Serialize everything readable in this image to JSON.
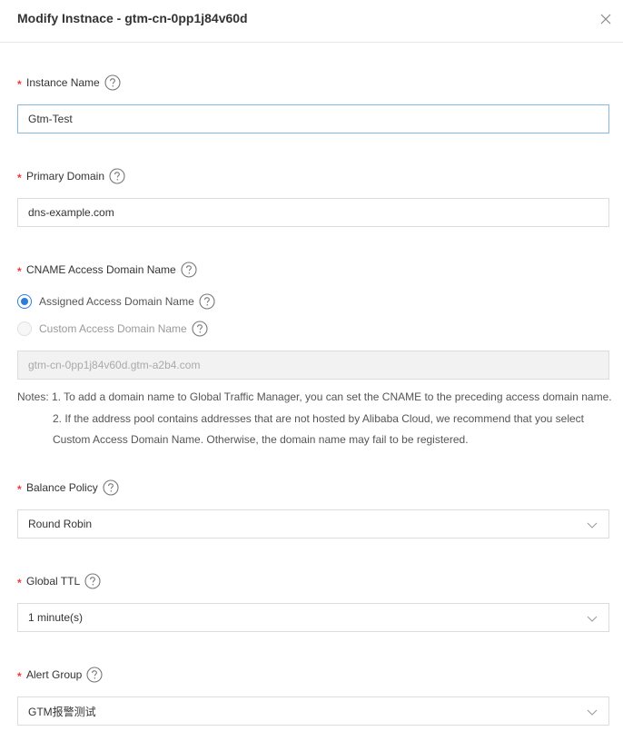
{
  "dialog": {
    "title": "Modify Instnace - gtm-cn-0pp1j84v60d"
  },
  "form": {
    "required_mark": "*",
    "instance_name": {
      "label": "Instance Name",
      "value": "Gtm-Test"
    },
    "primary_domain": {
      "label": "Primary Domain",
      "value": "dns-example.com"
    },
    "cname": {
      "label": "CNAME Access Domain Name",
      "options": [
        {
          "label": "Assigned Access Domain Name",
          "checked": true
        },
        {
          "label": "Custom Access Domain Name",
          "checked": false
        }
      ],
      "value": "gtm-cn-0pp1j84v60d.gtm-a2b4.com"
    },
    "notes": {
      "prefix": "Notes:",
      "line1": "1. To add a domain name to Global Traffic Manager, you can set the CNAME to the preceding access domain name.",
      "line2": "2. If the address pool contains addresses that are not hosted by Alibaba Cloud, we recommend that you select",
      "line3": "Custom Access Domain Name. Otherwise, the domain name may fail to be registered."
    },
    "balance_policy": {
      "label": "Balance Policy",
      "value": "Round Robin"
    },
    "global_ttl": {
      "label": "Global TTL",
      "value": "1 minute(s)"
    },
    "alert_group": {
      "label": "Alert Group",
      "value": "GTM报警测试"
    }
  },
  "colors": {
    "primary": "#2f7cd8",
    "required": "#ff3333",
    "focus_border": "#88b7e0"
  },
  "icons": {
    "close": "close-icon",
    "help": "help-circle-icon",
    "dropdown": "chevron-down-icon"
  }
}
